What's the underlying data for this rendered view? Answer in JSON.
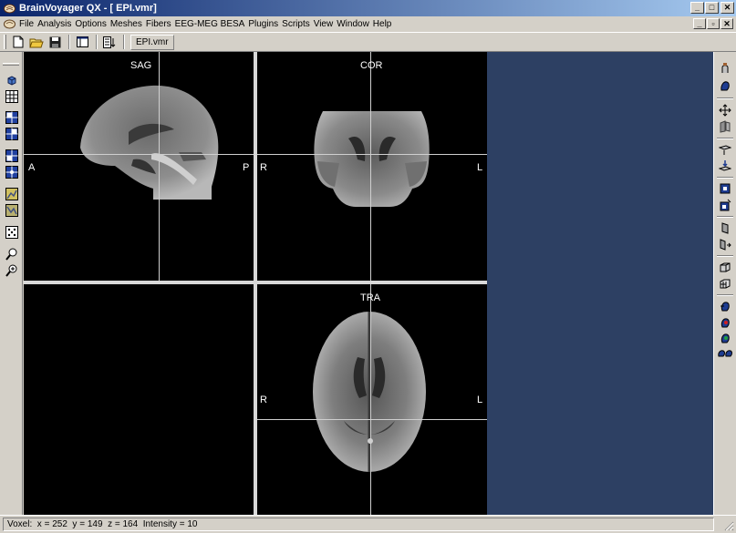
{
  "window": {
    "title": "BrainVoyager QX - [ EPI.vmr]"
  },
  "menu": {
    "items": [
      "File",
      "Analysis",
      "Options",
      "Meshes",
      "Fibers",
      "EEG-MEG BESA",
      "Plugins",
      "Scripts",
      "View",
      "Window",
      "Help"
    ]
  },
  "toolbar": {
    "document_tab": "EPI.vmr",
    "icons": [
      "new-document-icon",
      "open-folder-icon",
      "save-disk-icon",
      "window-layout-icon",
      "list-arrow-icon"
    ]
  },
  "viewer": {
    "sag": {
      "label": "SAG",
      "left_label": "A",
      "right_label": "P"
    },
    "cor": {
      "label": "COR",
      "left_label": "R",
      "right_label": "L"
    },
    "tra": {
      "label": "TRA",
      "left_label": "R",
      "right_label": "L"
    }
  },
  "status": {
    "text": "Voxel:  x = 252  y = 149  z = 164  Intensity = 10"
  },
  "colors": {
    "titlebar_start": "#0a246a",
    "titlebar_end": "#a6caf0",
    "workspace": "#2d4063",
    "chrome": "#d4d0c8"
  }
}
